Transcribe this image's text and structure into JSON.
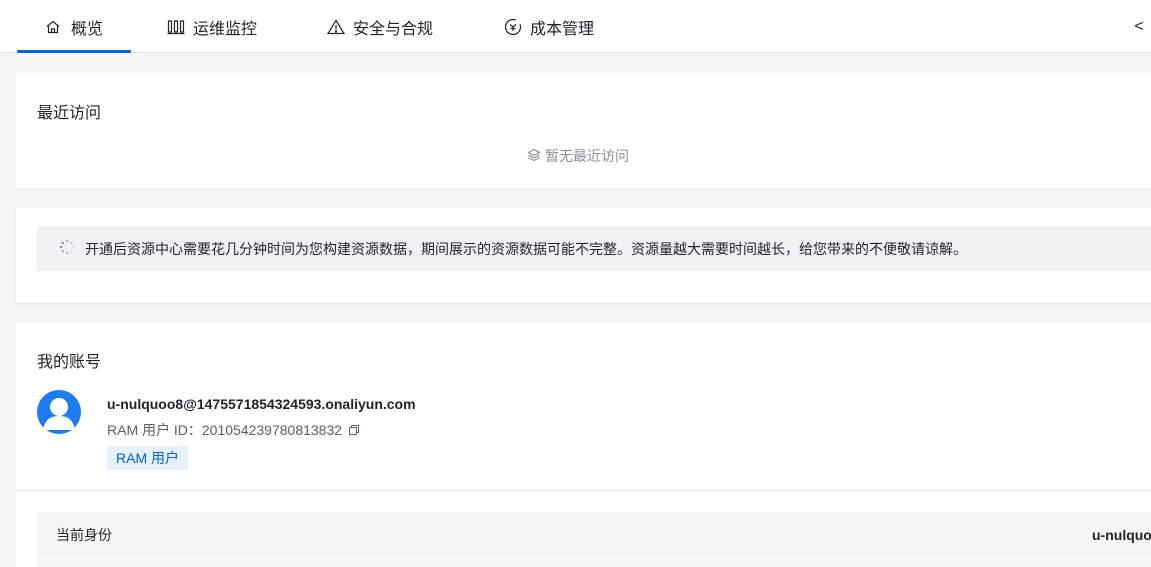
{
  "tabs": [
    {
      "label": "概览",
      "icon": "home-icon",
      "active": true
    },
    {
      "label": "运维监控",
      "icon": "bar-chart-icon",
      "active": false
    },
    {
      "label": "安全与合规",
      "icon": "warning-icon",
      "active": false
    },
    {
      "label": "成本管理",
      "icon": "cost-icon",
      "active": false
    }
  ],
  "tabs_scroll_label": "<",
  "recent": {
    "title": "最近访问",
    "empty_text": "暂无最近访问",
    "empty_icon": "layers-icon"
  },
  "notice": {
    "icon": "loading-spinner-icon",
    "text": "开通后资源中心需要花几分钟时间为您构建资源数据，期间展示的资源数据可能不完整。资源量越大需要时间越长，给您带来的不便敬请谅解。"
  },
  "account": {
    "title": "我的账号",
    "email": "u-nulquoo8@1475571854324593.onaliyun.com",
    "id_label": "RAM 用户 ID：",
    "id_value": "201054239780813832",
    "tag": "RAM 用户",
    "identity_label": "当前身份",
    "identity_value": "u-nulquo"
  },
  "colors": {
    "accent": "#0064c8",
    "avatar": "#1f7bf0",
    "tag_bg": "#e5f0fc",
    "page_bg": "#f4f6f8"
  }
}
